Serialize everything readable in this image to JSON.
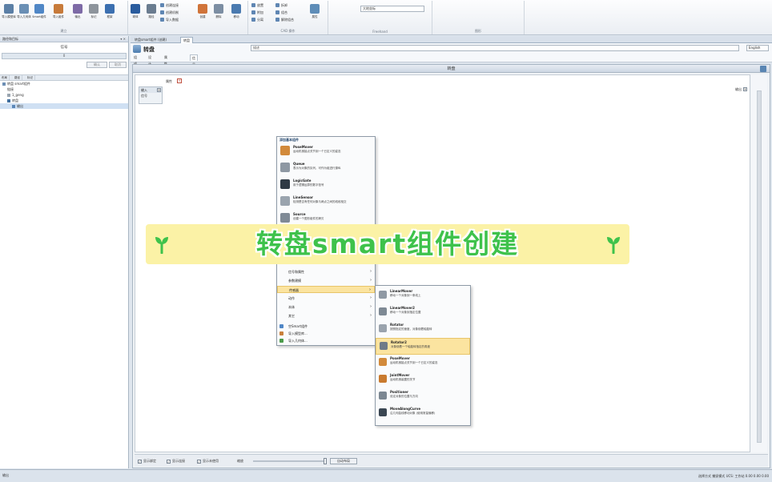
{
  "ribbon": {
    "buttons": [
      {
        "label": "导入模型库",
        "color": "#5b7fa6"
      },
      {
        "label": "导入几何体",
        "color": "#6a8fb5"
      },
      {
        "label": "Smart组件",
        "color": "#4f86c6"
      },
      {
        "label": "导入组件",
        "color": "#c77a3a"
      },
      {
        "label": "输出",
        "color": "#7d6aa6"
      },
      {
        "label": "标记",
        "color": "#8d949c"
      },
      {
        "label": "框架",
        "color": "#3b6fb0"
      },
      {
        "label": "球体",
        "color": "#2a5c9e"
      },
      {
        "label": "路径",
        "color": "#6a7c90"
      },
      {
        "label": "创建",
        "color": "#d0743a"
      },
      {
        "label": "删除",
        "color": "#7c8ea3"
      },
      {
        "label": "移动",
        "color": "#4a7ab0"
      },
      {
        "label": "属性",
        "color": "#5e8db8"
      }
    ],
    "small_items": [
      "创建连接",
      "创建机制",
      "导入数据",
      "放置",
      "附加",
      "分离",
      "拆卸",
      "组合",
      "解除组合"
    ],
    "groups": [
      "建立",
      "CAD 操作",
      "Freehand",
      "图形"
    ],
    "combo": "大地坐标"
  },
  "left_panel": {
    "title": "路径和目标",
    "field_label": "信号",
    "field_value": "0",
    "btn_1": "确认",
    "btn_2": "取消",
    "tabs": [
      "布局",
      "路径",
      "标记"
    ],
    "tree": [
      "转盘 smart组件",
      "链接",
      "1_geng",
      "转盘",
      "输出"
    ]
  },
  "doc_tabs": [
    "转盘smart组件 (创建)",
    "转盘"
  ],
  "header": {
    "title": "转盘",
    "description_placeholder": "描述",
    "lang": "English",
    "tabs": [
      "组成",
      "设计",
      "属性与连结",
      "信号和连接"
    ]
  },
  "canvas": {
    "title": "转盘",
    "props_label": "属性",
    "input_box_title": "输入",
    "input_row": "信号",
    "output_label": "输出",
    "bottom": {
      "check_1": "显示绑定",
      "check_2": "显示连接",
      "check_3": "显示未使用",
      "zoom_label": "缩放",
      "auto_btn": "自动布局"
    }
  },
  "context_menu": {
    "title": "添加基本组件",
    "items": [
      {
        "name": "PoseMover",
        "desc": "运动机械接点关节到一个已定义的姿态",
        "color": "#d28a3b"
      },
      {
        "name": "Queue",
        "desc": "表示为对象的队列，可作为组进行操纵",
        "color": "#8e98a3"
      },
      {
        "name": "LogicGate",
        "desc": "用于逻辑运算的数字信号",
        "color": "#2f3a45"
      },
      {
        "name": "LineSensor",
        "desc": "检测是否有任何对象与两点之间的线段相交",
        "color": "#9aa4ae"
      },
      {
        "name": "Source",
        "desc": "创建一个图形组件的拷贝",
        "color": "#7f8a96"
      }
    ],
    "submenus": [
      "信号和属性",
      "参数建模",
      "传感器",
      "动作",
      "本体",
      "其它"
    ],
    "extra": [
      "空Smart组件",
      "导入模型库...",
      "导入几何体..."
    ]
  },
  "sub_menu": {
    "items": [
      {
        "name": "LinearMover",
        "desc": "移动一个对象到一条线上",
        "color": "#8f99a4"
      },
      {
        "name": "LinearMover2",
        "desc": "移动一个对象到指定位置",
        "color": "#7e8994"
      },
      {
        "name": "Rotator",
        "desc": "按照指定的速度，对象绕着轴旋转",
        "color": "#9aa3ad"
      },
      {
        "name": "Rotator2",
        "desc": "对象绕着一个轴旋转指定的角度",
        "color": "#6f7b88"
      },
      {
        "name": "PoseMover",
        "desc": "运动机械接点关节到一个已定义的姿态",
        "color": "#d28a3b"
      },
      {
        "name": "JointMover",
        "desc": "运动机械装置的关节",
        "color": "#c97a2e"
      },
      {
        "name": "Positioner",
        "desc": "设定对象的位置与方向",
        "color": "#7c8792"
      },
      {
        "name": "MoveAlongCurve",
        "desc": "沿几何曲线移动对象 (使用常量偏移)",
        "color": "#3a4652"
      }
    ]
  },
  "banner": {
    "text": "转盘smart组件创建",
    "text_color": "#3ec24b",
    "bg_color": "#fbf2a6"
  },
  "status": {
    "left": "输出",
    "right": "选择方式  捕捉模式  UCS: 工作站  0.00  0.00  0.00"
  }
}
